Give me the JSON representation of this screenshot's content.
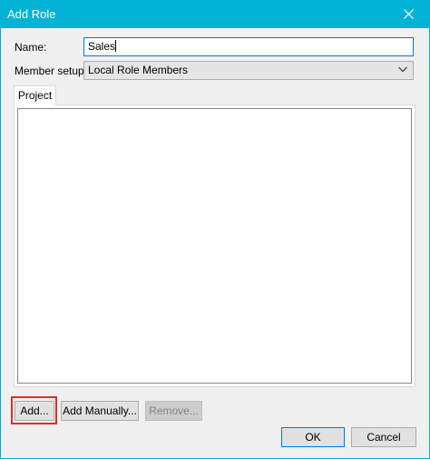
{
  "window": {
    "title": "Add Role"
  },
  "name_field": {
    "label": "Name:",
    "value": "Sales"
  },
  "member_setup": {
    "label": "Member setup:",
    "selected": "Local Role Members"
  },
  "tabs": [
    {
      "label": "Project"
    }
  ],
  "buttons": {
    "add": "Add...",
    "add_manually": "Add Manually...",
    "remove": "Remove...",
    "ok": "OK",
    "cancel": "Cancel"
  },
  "colors": {
    "titlebar": "#00b2d3",
    "highlight_box": "#d9302b",
    "focus_border": "#0078d7"
  },
  "icons": {
    "close": "close-icon",
    "dropdown": "chevron-down-icon"
  }
}
